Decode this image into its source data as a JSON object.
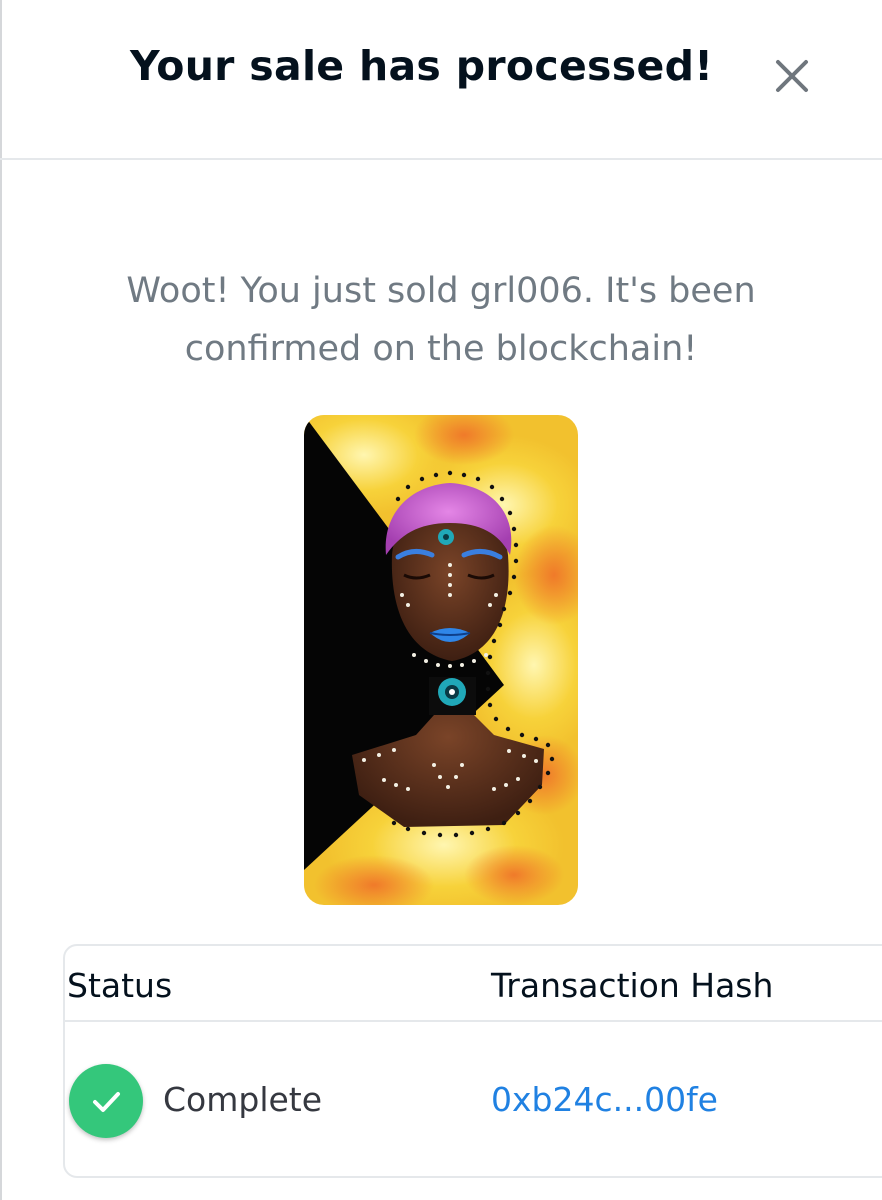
{
  "modal": {
    "title": "Your sale has processed!",
    "close_icon": "close-icon",
    "message": "Woot! You just sold grl006. It's been confirmed on the blockchain!"
  },
  "artwork": {
    "name": "grl006"
  },
  "table": {
    "headers": {
      "status": "Status",
      "hash": "Transaction Hash"
    },
    "row": {
      "status_icon": "check-circle-icon",
      "status": "Complete",
      "hash": "0xb24c...00fe"
    }
  },
  "colors": {
    "title": "#04111d",
    "message": "#707a83",
    "success": "#34c77b",
    "link": "#2081e2",
    "border": "#e5e8eb"
  }
}
